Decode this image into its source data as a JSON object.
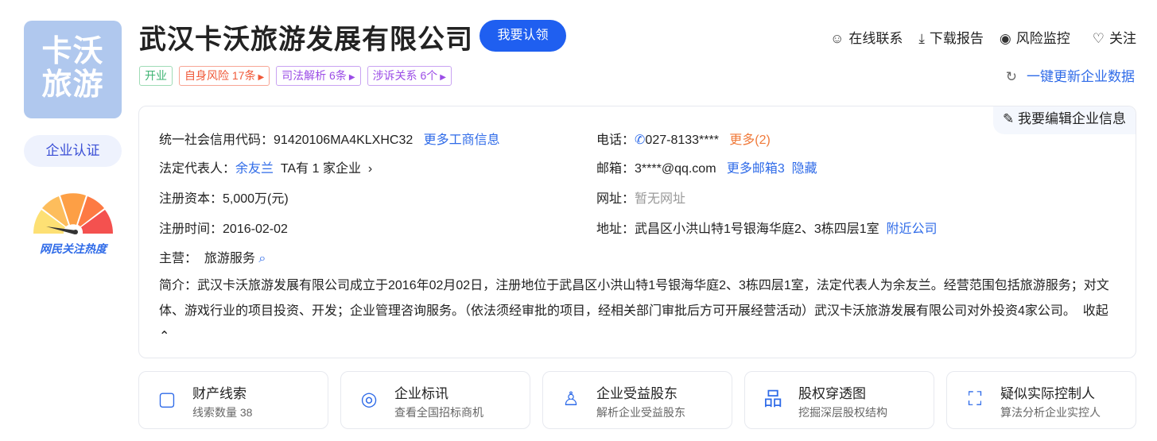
{
  "logo_text": "卡沃旅游",
  "logo_lines": [
    "卡沃",
    "旅游"
  ],
  "cert_label": "企业认证",
  "heat_label": "网民关注热度",
  "company_name": "武汉卡沃旅游发展有限公司",
  "claim_label": "我要认领",
  "tags": [
    {
      "label": "开业",
      "color": "#3cb371"
    },
    {
      "label": "自身风险 17条",
      "color": "#f05a3a"
    },
    {
      "label": "司法解析 6条",
      "color": "#9b4de6"
    },
    {
      "label": "涉诉关系 6个",
      "color": "#9b4de6"
    }
  ],
  "actions": [
    {
      "icon": "chat-icon",
      "glyph": "☺",
      "label": "在线联系"
    },
    {
      "icon": "download-icon",
      "glyph": "⤓",
      "label": "下载报告"
    },
    {
      "icon": "eye-icon",
      "glyph": "◉",
      "label": "风险监控"
    },
    {
      "icon": "heart-icon",
      "glyph": "♡",
      "label": "关注"
    }
  ],
  "update_label": "一键更新企业数据",
  "edit_label": "我要编辑企业信息",
  "info": {
    "credit_code_label": "统一社会信用代码：",
    "credit_code": "91420106MA4KLXHC32",
    "more_biz": "更多工商信息",
    "legal_label": "法定代表人：",
    "legal_name": "余友兰",
    "legal_extra": "TA有 1 家企业",
    "capital_label": "注册资本：",
    "capital": "5,000万(元)",
    "reg_time_label": "注册时间：",
    "reg_time": "2016-02-02",
    "main_label": "主营：",
    "main": "旅游服务",
    "phone_label": "电话：",
    "phone": "027-8133****",
    "phone_more": "更多(2)",
    "email_label": "邮箱：",
    "email": "3****@qq.com",
    "email_more": "更多邮箱3",
    "email_hide": "隐藏",
    "web_label": "网址：",
    "web": "暂无网址",
    "addr_label": "地址：",
    "addr": "武昌区小洪山特1号银海华庭2、3栋四层1室",
    "addr_near": "附近公司",
    "intro": "简介：武汉卡沃旅游发展有限公司成立于2016年02月02日，注册地位于武昌区小洪山特1号银海华庭2、3栋四层1室，法定代表人为余友兰。经营范围包括旅游服务；对文体、游戏行业的项目投资、开发；企业管理咨询服务。（依法须经审批的项目，经相关部门审批后方可开展经营活动）武汉卡沃旅游发展有限公司对外投资4家公司。",
    "collapse": "收起"
  },
  "cards": [
    {
      "icon": "folder-icon",
      "glyph": "▢",
      "title": "财产线索",
      "sub": "线索数量 38"
    },
    {
      "icon": "target-icon",
      "glyph": "◎",
      "title": "企业标讯",
      "sub": "查看全国招标商机"
    },
    {
      "icon": "person-icon",
      "glyph": "♙",
      "title": "企业受益股东",
      "sub": "解析企业受益股东"
    },
    {
      "icon": "org-chart-icon",
      "glyph": "品",
      "title": "股权穿透图",
      "sub": "挖掘深层股权结构"
    },
    {
      "icon": "scan-person-icon",
      "glyph": "⛶",
      "title": "疑似实际控制人",
      "sub": "算法分析企业实控人"
    }
  ]
}
